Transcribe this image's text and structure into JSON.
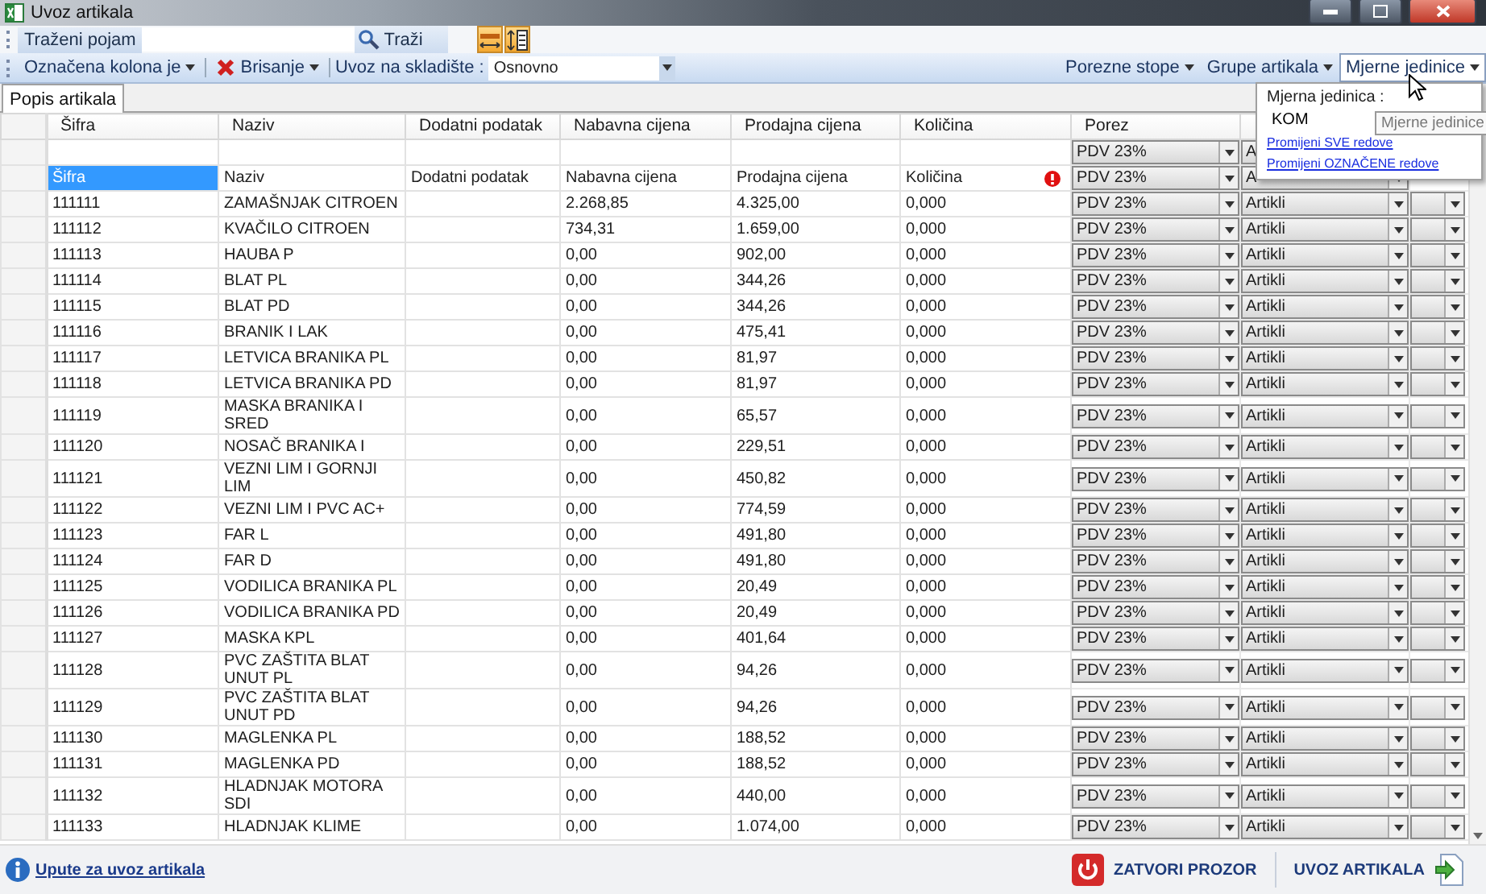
{
  "window": {
    "title": "Uvoz artikala"
  },
  "search_bar": {
    "label": "Traženi pojam",
    "button": "Traži"
  },
  "toolbar": {
    "menus": [
      {
        "label": "Označena kolona je",
        "kind": "plain"
      },
      {
        "label": "Brisanje",
        "kind": "delete"
      }
    ],
    "warehouse": {
      "label": "Uvoz na skladište :",
      "value": "Osnovno"
    },
    "right_menus": [
      {
        "label": "Porezne stope",
        "pressed": false
      },
      {
        "label": "Grupe artikala",
        "pressed": false
      },
      {
        "label": "Mjerne jedinice",
        "pressed": true
      }
    ]
  },
  "tabs": [
    {
      "label": "Popis artikala",
      "selected": true
    }
  ],
  "table": {
    "columns": [
      "Šifra",
      "Naziv",
      "Dodatni podatak",
      "Nabavna cijena",
      "Prodajna cijena",
      "Količina",
      "Porez"
    ],
    "filter_row": {
      "porez": "PDV 23%",
      "grupa": "A"
    },
    "caption_row": {
      "cells": [
        {
          "text": "Šifra",
          "selected": true,
          "error": false
        },
        {
          "text": "Naziv",
          "selected": false,
          "error": false
        },
        {
          "text": "Dodatni podatak",
          "selected": false,
          "error": false
        },
        {
          "text": "Nabavna cijena",
          "selected": false,
          "error": false
        },
        {
          "text": "Prodajna cijena",
          "selected": false,
          "error": false
        },
        {
          "text": "Količina",
          "selected": false,
          "error": true
        }
      ],
      "porez": "PDV 23%",
      "grupa": "A"
    },
    "rows": [
      {
        "sifra": "111111",
        "naziv": "ZAMAŠNJAK CITROEN",
        "nabavna": "2.268,85",
        "prodajna": "4.325,00",
        "kolicina": "0,000",
        "porez": "PDV 23%",
        "grupa": "Artikli"
      },
      {
        "sifra": "111112",
        "naziv": "KVAČILO CITROEN",
        "nabavna": "734,31",
        "prodajna": "1.659,00",
        "kolicina": "0,000",
        "porez": "PDV 23%",
        "grupa": "Artikli"
      },
      {
        "sifra": "111113",
        "naziv": "HAUBA P",
        "nabavna": "0,00",
        "prodajna": "902,00",
        "kolicina": "0,000",
        "porez": "PDV 23%",
        "grupa": "Artikli"
      },
      {
        "sifra": "111114",
        "naziv": "BLAT PL",
        "nabavna": "0,00",
        "prodajna": "344,26",
        "kolicina": "0,000",
        "porez": "PDV 23%",
        "grupa": "Artikli"
      },
      {
        "sifra": "111115",
        "naziv": "BLAT PD",
        "nabavna": "0,00",
        "prodajna": "344,26",
        "kolicina": "0,000",
        "porez": "PDV 23%",
        "grupa": "Artikli"
      },
      {
        "sifra": "111116",
        "naziv": "BRANIK I LAK",
        "nabavna": "0,00",
        "prodajna": "475,41",
        "kolicina": "0,000",
        "porez": "PDV 23%",
        "grupa": "Artikli"
      },
      {
        "sifra": "111117",
        "naziv": "LETVICA BRANIKA PL",
        "nabavna": "0,00",
        "prodajna": "81,97",
        "kolicina": "0,000",
        "porez": "PDV 23%",
        "grupa": "Artikli"
      },
      {
        "sifra": "111118",
        "naziv": "LETVICA BRANIKA PD",
        "nabavna": "0,00",
        "prodajna": "81,97",
        "kolicina": "0,000",
        "porez": "PDV 23%",
        "grupa": "Artikli"
      },
      {
        "sifra": "111119",
        "naziv": "MASKA BRANIKA I SRED",
        "nabavna": "0,00",
        "prodajna": "65,57",
        "kolicina": "0,000",
        "porez": "PDV 23%",
        "grupa": "Artikli"
      },
      {
        "sifra": "111120",
        "naziv": "NOSAČ BRANIKA I",
        "nabavna": "0,00",
        "prodajna": "229,51",
        "kolicina": "0,000",
        "porez": "PDV 23%",
        "grupa": "Artikli"
      },
      {
        "sifra": "111121",
        "naziv": "VEZNI LIM I GORNJI LIM",
        "nabavna": "0,00",
        "prodajna": "450,82",
        "kolicina": "0,000",
        "porez": "PDV 23%",
        "grupa": "Artikli"
      },
      {
        "sifra": "111122",
        "naziv": "VEZNI LIM I PVC AC+",
        "nabavna": "0,00",
        "prodajna": "774,59",
        "kolicina": "0,000",
        "porez": "PDV 23%",
        "grupa": "Artikli"
      },
      {
        "sifra": "111123",
        "naziv": "FAR L",
        "nabavna": "0,00",
        "prodajna": "491,80",
        "kolicina": "0,000",
        "porez": "PDV 23%",
        "grupa": "Artikli"
      },
      {
        "sifra": "111124",
        "naziv": "FAR D",
        "nabavna": "0,00",
        "prodajna": "491,80",
        "kolicina": "0,000",
        "porez": "PDV 23%",
        "grupa": "Artikli"
      },
      {
        "sifra": "111125",
        "naziv": "VODILICA BRANIKA PL",
        "nabavna": "0,00",
        "prodajna": "20,49",
        "kolicina": "0,000",
        "porez": "PDV 23%",
        "grupa": "Artikli"
      },
      {
        "sifra": "111126",
        "naziv": "VODILICA BRANIKA PD",
        "nabavna": "0,00",
        "prodajna": "20,49",
        "kolicina": "0,000",
        "porez": "PDV 23%",
        "grupa": "Artikli"
      },
      {
        "sifra": "111127",
        "naziv": "MASKA KPL",
        "nabavna": "0,00",
        "prodajna": "401,64",
        "kolicina": "0,000",
        "porez": "PDV 23%",
        "grupa": "Artikli"
      },
      {
        "sifra": "111128",
        "naziv": "PVC ZAŠTITA BLAT UNUT PL",
        "nabavna": "0,00",
        "prodajna": "94,26",
        "kolicina": "0,000",
        "porez": "PDV 23%",
        "grupa": "Artikli"
      },
      {
        "sifra": "111129",
        "naziv": "PVC ZAŠTITA BLAT UNUT PD",
        "nabavna": "0,00",
        "prodajna": "94,26",
        "kolicina": "0,000",
        "porez": "PDV 23%",
        "grupa": "Artikli"
      },
      {
        "sifra": "111130",
        "naziv": "MAGLENKA PL",
        "nabavna": "0,00",
        "prodajna": "188,52",
        "kolicina": "0,000",
        "porez": "PDV 23%",
        "grupa": "Artikli"
      },
      {
        "sifra": "111131",
        "naziv": "MAGLENKA PD",
        "nabavna": "0,00",
        "prodajna": "188,52",
        "kolicina": "0,000",
        "porez": "PDV 23%",
        "grupa": "Artikli"
      },
      {
        "sifra": "111132",
        "naziv": "HLADNJAK MOTORA SDI",
        "nabavna": "0,00",
        "prodajna": "440,00",
        "kolicina": "0,000",
        "porez": "PDV 23%",
        "grupa": "Artikli"
      },
      {
        "sifra": "111133",
        "naziv": "HLADNJAK KLIME",
        "nabavna": "0,00",
        "prodajna": "1.074,00",
        "kolicina": "0,000",
        "porez": "PDV 23%",
        "grupa": "Artikli"
      }
    ]
  },
  "unit_menu": {
    "label": "Mjerna jedinica :",
    "value": "KOM",
    "links": [
      "Promijeni SVE redove",
      "Promijeni OZNAČENE redove"
    ],
    "tooltip": "Mjerne jedinice"
  },
  "footer": {
    "help_link": "Upute za uvoz artikala",
    "buttons": [
      {
        "label": "ZATVORI PROZOR",
        "kind": "close"
      },
      {
        "label": "UVOZ ARTIKALA",
        "kind": "import"
      }
    ]
  }
}
